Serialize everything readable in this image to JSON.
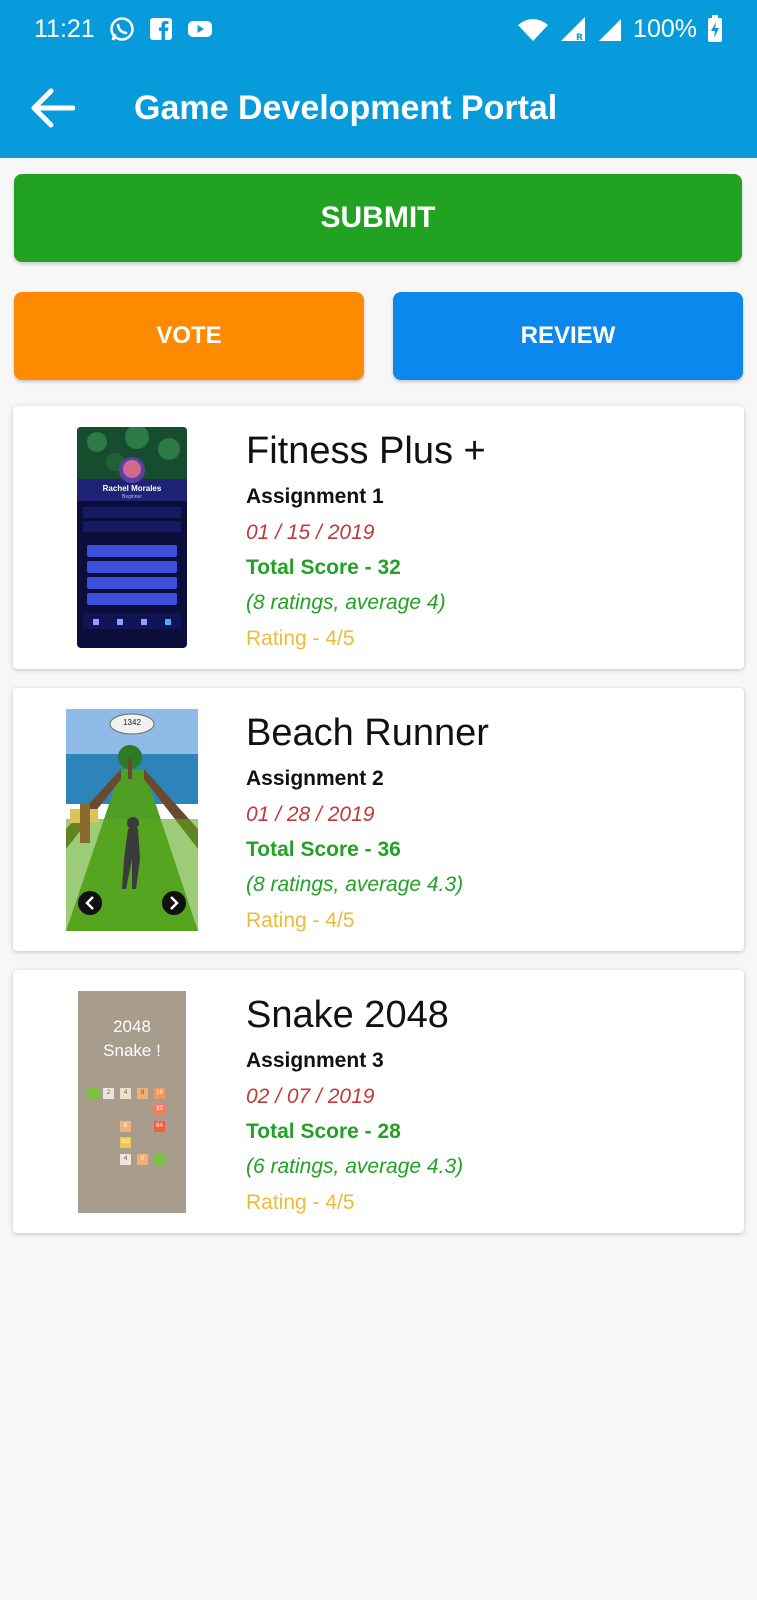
{
  "status_bar": {
    "time": "11:21",
    "battery": "100%",
    "notification_icons": [
      "whatsapp-icon",
      "facebook-icon",
      "youtube-icon"
    ],
    "system_icons": [
      "wifi-icon",
      "signal-icon",
      "signal-roaming-icon",
      "battery-charging-icon"
    ]
  },
  "app_bar": {
    "title": "Game Development Portal",
    "background": "#079bdc"
  },
  "actions": {
    "submit_label": "SUBMIT",
    "vote_label": "VOTE",
    "review_label": "REVIEW",
    "submit_color": "#21a321",
    "vote_color": "#fd8a00",
    "review_color": "#0b88ee"
  },
  "projects": [
    {
      "name": "Fitness Plus +",
      "assignment": "Assignment 1",
      "date": "01 / 15 / 2019",
      "total_score": "Total Score - 32",
      "ratings": "(8 ratings, average 4)",
      "rating": "Rating - 4/5",
      "thumbnail": {
        "profile_name": "Rachel Morales",
        "profile_sub": "Beginner"
      }
    },
    {
      "name": "Beach Runner",
      "assignment": "Assignment 2",
      "date": "01 / 28 / 2019",
      "total_score": "Total Score - 36",
      "ratings": "(8 ratings, average 4.3)",
      "rating": "Rating - 4/5",
      "thumbnail": {
        "score_bubble": "1342"
      }
    },
    {
      "name": "Snake 2048",
      "assignment": "Assignment 3",
      "date": "02 / 07 / 2019",
      "total_score": "Total Score - 28",
      "ratings": "(6 ratings, average 4.3)",
      "rating": "Rating - 4/5",
      "thumbnail": {
        "title_line1": "2048",
        "title_line2": "Snake !",
        "tiles": [
          "2",
          "4",
          "8",
          "16",
          "32",
          "64",
          "8",
          "512",
          "4",
          "8"
        ]
      }
    }
  ],
  "colors": {
    "date": "#c0393b",
    "score": "#23a127",
    "rating": "#e9bc3a"
  }
}
